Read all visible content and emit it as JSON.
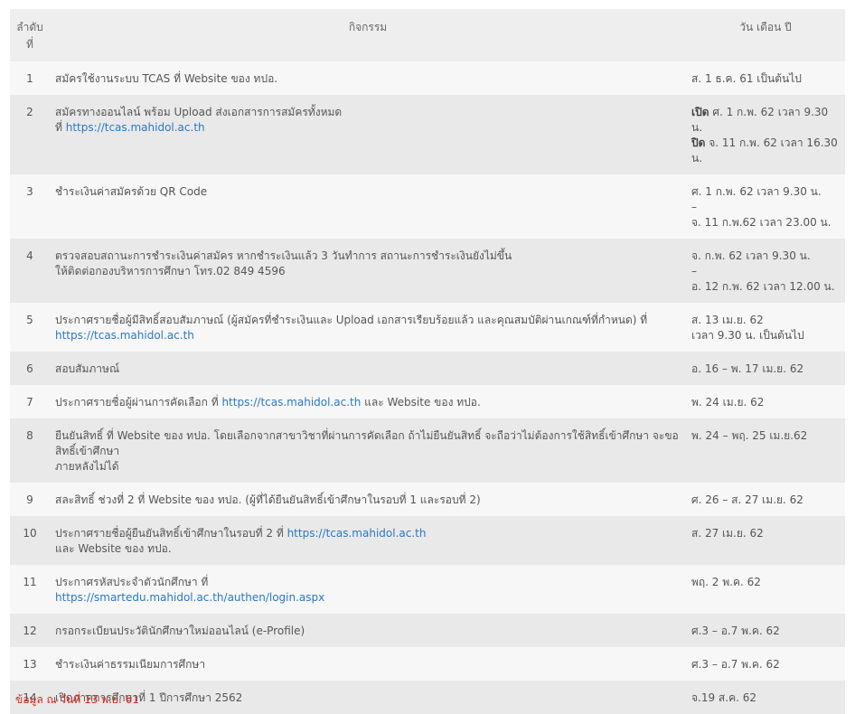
{
  "table": {
    "headers": {
      "no": "ลำดับ\nที่",
      "activity": "กิจกรรม",
      "date": "วัน เดือน ปี"
    },
    "rows": [
      {
        "no": "1",
        "activity": [
          "สมัครใช้งานระบบ TCAS ที่ Website ของ ทปอ."
        ],
        "date": [
          "ส. 1 ธ.ค. 61 เป็นต้นไป"
        ]
      },
      {
        "no": "2",
        "activity": [
          "สมัครทางออนไลน์ พร้อม Upload ส่งเอกสารการสมัครทั้งหมด"
        ],
        "act_link_prefix": "ที่ ",
        "act_link": "https://tcas.mahidol.ac.th",
        "date_open_label": "เปิด",
        "date_open": " ศ. 1 ก.พ. 62 เวลา 9.30 น.",
        "date_close_label": "ปิด",
        "date_close": " จ. 11 ก.พ. 62 เวลา 16.30 น."
      },
      {
        "no": "3",
        "activity": [
          "ชำระเงินค่าสมัครด้วย QR Code"
        ],
        "date": [
          "ศ. 1 ก.พ. 62 เวลา 9.30 น.",
          "–",
          "จ. 11 ก.พ.62 เวลา 23.00 น."
        ]
      },
      {
        "no": "4",
        "activity": [
          "ตรวจสอบสถานะการชำระเงินค่าสมัคร หากชำระเงินแล้ว 3 วันทำการ สถานะการชำระเงินยังไม่ขึ้น",
          "ให้ติดต่อกองบริหารการศึกษา โทร.02 849 4596"
        ],
        "date": [
          "จ. ก.พ. 62 เวลา 9.30 น.",
          "–",
          "อ. 12 ก.พ. 62 เวลา 12.00 น."
        ]
      },
      {
        "no": "5",
        "activity": [
          "ประกาศรายชื่อผู้มีสิทธิ์สอบสัมภาษณ์ (ผู้สมัครที่ชำระเงินและ Upload เอกสารเรียบร้อยแล้ว และคุณสมบัติผ่านเกณฑ์ที่กำหนด) ที่"
        ],
        "act_link": "https://tcas.mahidol.ac.th",
        "date": [
          "ส. 13 เม.ย. 62",
          "เวลา 9.30 น. เป็นต้นไป"
        ]
      },
      {
        "no": "6",
        "activity": [
          "สอบสัมภาษณ์"
        ],
        "date": [
          "อ. 16 – พ. 17 เม.ย. 62"
        ]
      },
      {
        "no": "7",
        "act_pre": "ประกาศรายชื่อผู้ผ่านการคัดเลือก ที่ ",
        "act_link": "https://tcas.mahidol.ac.th",
        "act_post": " และ Website ของ ทปอ.",
        "date": [
          "พ. 24 เม.ย. 62"
        ]
      },
      {
        "no": "8",
        "activity": [
          "ยืนยันสิทธิ์ ที่ Website ของ ทปอ. โดยเลือกจากสาขาวิชาที่ผ่านการคัดเลือก ถ้าไม่ยืนยันสิทธิ์ จะถือว่าไม่ต้องการใช้สิทธิ์เข้าศึกษา จะขอสิทธิ์เข้าศึกษา",
          "ภายหลังไม่ได้"
        ],
        "date": [
          "พ. 24 – พฤ. 25 เม.ย.62"
        ]
      },
      {
        "no": "9",
        "activity": [
          "สละสิทธิ์ ช่วงที่ 2 ที่ Website ของ ทปอ. (ผู้ที่ได้ยืนยันสิทธิ์เข้าศึกษาในรอบที่ 1 และรอบที่ 2)"
        ],
        "date": [
          "ศ. 26 – ส. 27 เม.ย. 62"
        ]
      },
      {
        "no": "10",
        "act_pre": "ประกาศรายชื่อผู้ยืนยันสิทธิ์เข้าศึกษาในรอบที่ 2 ที่ ",
        "act_link": "https://tcas.mahidol.ac.th",
        "act_post_line": "และ Website ของ ทปอ.",
        "date": [
          "ส. 27 เม.ย. 62"
        ]
      },
      {
        "no": "11",
        "activity": [
          "ประกาศรหัสประจำตัวนักศึกษา ที่"
        ],
        "act_link": "https://smartedu.mahidol.ac.th/authen/login.aspx",
        "date": [
          "พฤ. 2 พ.ค. 62"
        ]
      },
      {
        "no": "12",
        "activity": [
          "กรอกระเบียนประวัตินักศึกษาใหม่ออนไลน์ (e-Profile)"
        ],
        "date": [
          "ศ.3 – อ.7 พ.ค. 62"
        ]
      },
      {
        "no": "13",
        "activity": [
          "ชำระเงินค่าธรรมเนียมการศึกษา"
        ],
        "date": [
          "ศ.3 – อ.7 พ.ค. 62"
        ]
      },
      {
        "no": "14",
        "activity": [
          "เปิดภาคการศึกษาที่ 1 ปีการศึกษา 2562"
        ],
        "date": [
          "จ.19 ส.ค. 62"
        ]
      }
    ]
  },
  "footnote": "ข้อมูล ณ วันที่ 13 พ.ย. 61"
}
